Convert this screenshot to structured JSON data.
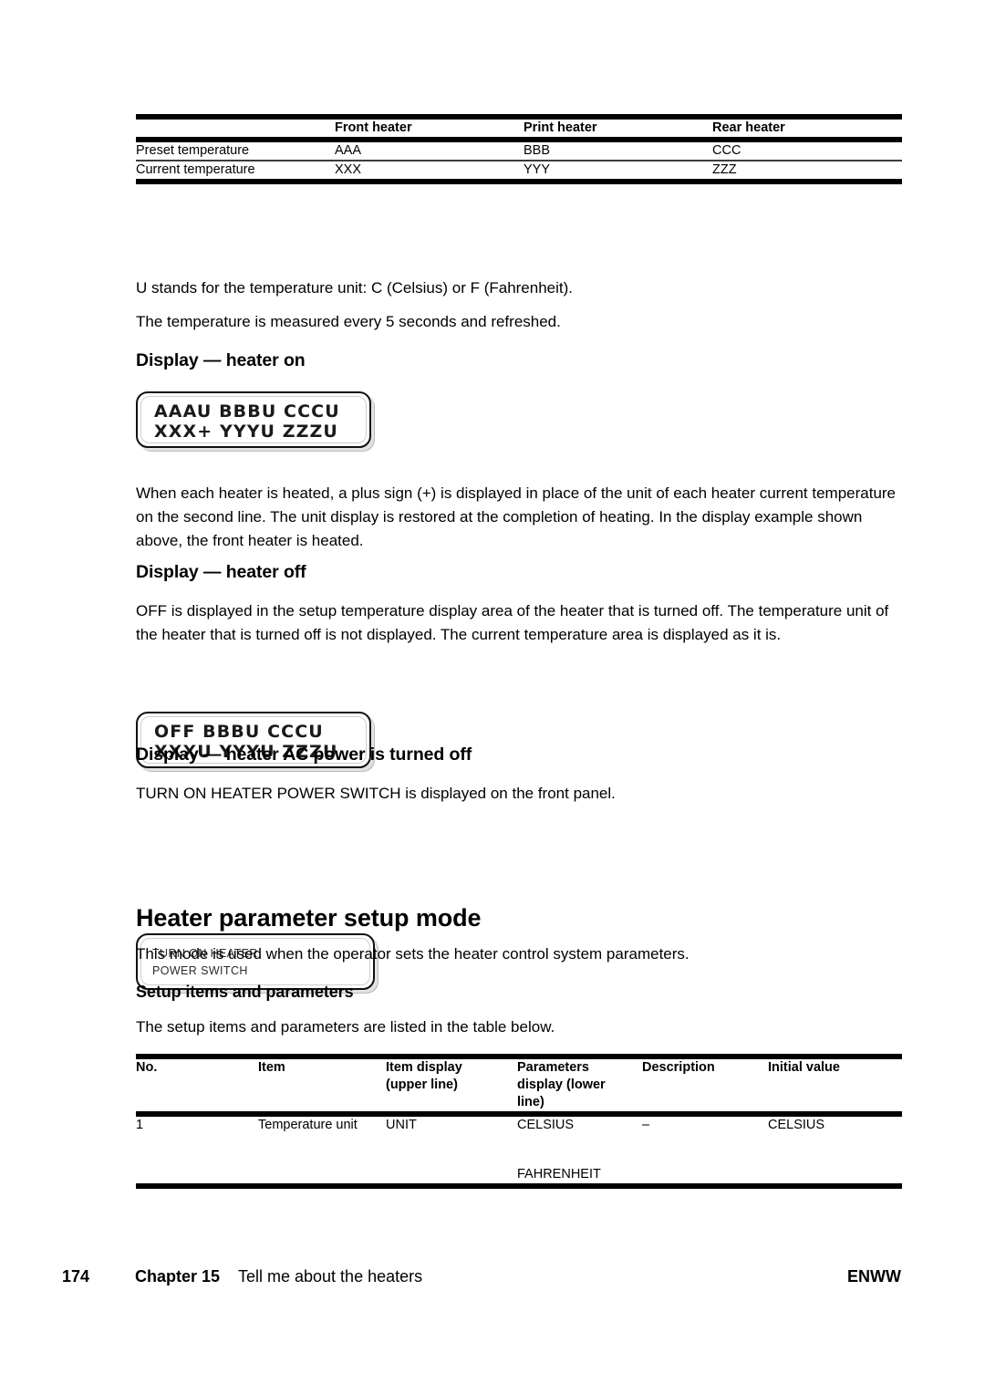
{
  "document": {
    "page_number": "174",
    "chapter": "Chapter 15",
    "chapter_title": "Tell me about the heaters",
    "imprint": "ENWW"
  },
  "temperature_table": {
    "headers": [
      "",
      "Front heater",
      "Print heater",
      "Rear heater"
    ],
    "rows": [
      [
        "Preset temperature",
        "AAA",
        "BBB",
        "CCC"
      ],
      [
        "Current temperature",
        "XXX",
        "YYY",
        "ZZZ"
      ]
    ]
  },
  "notes": {
    "unit_note": "U stands for the temperature unit: C (Celsius) or F (Fahrenheit).",
    "refresh_note": "The temperature is measured every 5 seconds and refreshed."
  },
  "heater_on": {
    "heading": "Display — heater on",
    "lcd_line1": "AAAU BBBU CCCU",
    "lcd_line2": "XXX+ YYYU ZZZU",
    "body": "When each heater is heated, a plus sign (+) is displayed in place of the unit of each heater current temperature on the second line. The unit display is restored at the completion of heating. In the display example shown above, the front heater is heated."
  },
  "heater_off": {
    "heading": "Display — heater off",
    "body": "OFF is displayed in the setup temperature display area of the heater that is turned off. The temperature unit of the heater that is turned off is not displayed. The current temperature area is displayed as it is.",
    "lcd_line1": "OFF BBBU CCCU",
    "lcd_line2": "XXXU YYYU ZZZU"
  },
  "heater_ac_off": {
    "heading": "Display — heater AC power is turned off",
    "body": "TURN ON HEATER POWER SWITCH is displayed on the front panel.",
    "lcd_line1": "TURN ON HEATER",
    "lcd_line2": "POWER SWITCH"
  },
  "setup_mode": {
    "heading": "Heater parameter setup mode",
    "body": "This mode is used when the operator sets the heater control system parameters.",
    "sub_heading": "Setup items and parameters",
    "sub_body": "The setup items and parameters are listed in the table below."
  },
  "parameters_table": {
    "headers": [
      "No.",
      "Item",
      "Item display (upper line)",
      "Parameters display (lower line)",
      "Description",
      "Initial value"
    ],
    "headers_split": {
      "col2_line1": "Item display",
      "col2_line2": "(upper line)",
      "col3_line1": "Parameters",
      "col3_line2": "display (lower",
      "col3_line3": "line)"
    },
    "rows": [
      {
        "no": "1",
        "item": "Temperature unit",
        "item_display": "UNIT",
        "parameters_display_1": "CELSIUS",
        "parameters_display_2": "FAHRENHEIT",
        "description": "–",
        "initial_value": "CELSIUS"
      }
    ]
  }
}
